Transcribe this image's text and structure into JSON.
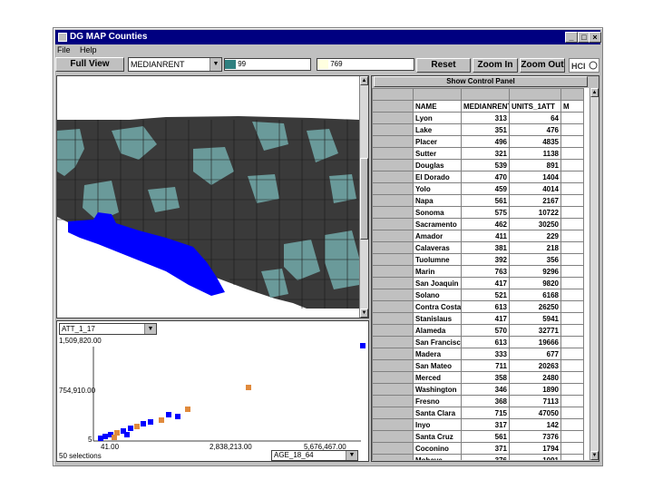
{
  "window": {
    "title": "DG MAP   Counties",
    "menu": [
      "File",
      "Help"
    ]
  },
  "toolbar": {
    "full_view": "Full View",
    "attribute": "MEDIANRENT",
    "low_value": "99",
    "high_value": "769",
    "reset": "Reset",
    "zoom_in": "Zoom In",
    "zoom_out": "Zoom Out"
  },
  "colors": {
    "low": "#2f8080",
    "high": "#ffffe0",
    "selection": "#0000ff",
    "map_dark": "#3a3a3a",
    "map_teal": "#6a9a9a",
    "scatter_orange": "#e08a3c"
  },
  "table": {
    "panel_label": "Show Control Panel",
    "columns": [
      "NAME",
      "MEDIANRENT",
      "UNITS_1ATT",
      "M"
    ],
    "rows": [
      [
        "Lyon",
        "313",
        "64"
      ],
      [
        "Lake",
        "351",
        "476"
      ],
      [
        "Placer",
        "496",
        "4835"
      ],
      [
        "Sutter",
        "321",
        "1138"
      ],
      [
        "Douglas",
        "539",
        "891"
      ],
      [
        "El Dorado",
        "470",
        "1404"
      ],
      [
        "Yolo",
        "459",
        "4014"
      ],
      [
        "Napa",
        "561",
        "2167"
      ],
      [
        "Sonoma",
        "575",
        "10722"
      ],
      [
        "Sacramento",
        "462",
        "30250"
      ],
      [
        "Amador",
        "411",
        "229"
      ],
      [
        "Calaveras",
        "381",
        "218"
      ],
      [
        "Tuolumne",
        "392",
        "356"
      ],
      [
        "Marin",
        "763",
        "9296"
      ],
      [
        "San Joaquin",
        "417",
        "9820"
      ],
      [
        "Solano",
        "521",
        "6168"
      ],
      [
        "Contra Costa",
        "613",
        "26250"
      ],
      [
        "Stanislaus",
        "417",
        "5941"
      ],
      [
        "Alameda",
        "570",
        "32771"
      ],
      [
        "San Francisco",
        "613",
        "19666"
      ],
      [
        "Madera",
        "333",
        "677"
      ],
      [
        "San Mateo",
        "711",
        "20263"
      ],
      [
        "Merced",
        "358",
        "2480"
      ],
      [
        "Washington",
        "346",
        "1890"
      ],
      [
        "Fresno",
        "368",
        "7113"
      ],
      [
        "Santa Clara",
        "715",
        "47050"
      ],
      [
        "Inyo",
        "317",
        "142"
      ],
      [
        "Santa Cruz",
        "561",
        "7376"
      ],
      [
        "Coconino",
        "371",
        "1794"
      ],
      [
        "Mohave",
        "376",
        "1091"
      ]
    ]
  },
  "scatter": {
    "x_attribute": "ATT_1_17",
    "y_max_label": "1,509,820.00",
    "y_mid_label": "754,910.00",
    "y_min_label": "5",
    "x_min_label": "41.00",
    "x_mid_label": "2,838,213.00",
    "x_max_label": "5,676,467.00",
    "y_attribute": "AGE_18_64",
    "selections": "50 selections"
  }
}
